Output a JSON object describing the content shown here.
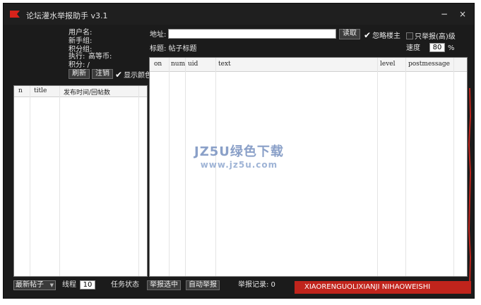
{
  "titlebar": {
    "title": "论坛灌水举报助手 v3.1",
    "minimize": "−",
    "close": "×"
  },
  "user_info": {
    "username_label": "用户名:",
    "newbie_label": "新手组:",
    "points_label": "积分组:",
    "exec_label": "执行:",
    "gold_label": "高等币:",
    "score_label": "积分: /"
  },
  "left_buttons": {
    "refresh": "刷新",
    "logout": "注销",
    "show_color": "显示颜色"
  },
  "url_bar": {
    "label": "地址:",
    "value": "",
    "read_button": "读取",
    "ignore_owner": "忽略楼主",
    "report_only": "只举报(高)级"
  },
  "topic": {
    "label": "标题: 帖子标题",
    "speed_label": "速度",
    "speed_value": "80",
    "speed_unit": "%"
  },
  "left_table": {
    "columns": [
      "n",
      "title",
      "发布时间/回帖数"
    ]
  },
  "main_table": {
    "columns": [
      "on",
      "num",
      "uid",
      "text",
      "level",
      "postmessage"
    ]
  },
  "footer": {
    "thread_select": "最新帖子",
    "threads_label": "线程",
    "threads_value": "10",
    "task_status_label": "任务状态",
    "report_selected": "举报选中",
    "auto_report": "自动举报",
    "report_record": "举报记录: 0",
    "marquee_text": "XIAORENGUOLIXIANJI NIHAOWEISHI"
  },
  "watermark": {
    "line1": "JZ5U绿色下载",
    "line2": "www.jz5u.com"
  },
  "colors": {
    "window_bg": "#1b1b1b",
    "accent_red": "#c0241c",
    "watermark": "#8aa0c8"
  }
}
